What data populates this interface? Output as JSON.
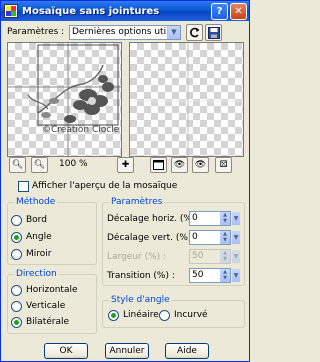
{
  "window": {
    "title": "Mosaïque sans jointures",
    "help": "?",
    "close": "✕"
  },
  "presets": {
    "label": "Paramètres :",
    "value": "Dernières options utilisées"
  },
  "preview": {
    "watermark": "©Creation Clocle",
    "zoom": "100 %"
  },
  "checkbox_preview": {
    "label": "Afficher l'aperçu de la mosaïque",
    "checked": false
  },
  "method": {
    "title": "Méthode",
    "options": [
      {
        "label": "Bord",
        "selected": false
      },
      {
        "label": "Angle",
        "selected": true
      },
      {
        "label": "Miroir",
        "selected": false
      }
    ]
  },
  "direction": {
    "title": "Direction",
    "options": [
      {
        "label": "Horizontale",
        "selected": false
      },
      {
        "label": "Verticale",
        "selected": false
      },
      {
        "label": "Bilatérale",
        "selected": true
      }
    ]
  },
  "params": {
    "title": "Paramètres",
    "fields": [
      {
        "label": "Décalage horiz. (%) :",
        "value": "0",
        "enabled": true
      },
      {
        "label": "Décalage vert. (%) :",
        "value": "0",
        "enabled": true
      },
      {
        "label": "Largeur (%) :",
        "value": "50",
        "enabled": false
      },
      {
        "label": "Transition (%) :",
        "value": "50",
        "enabled": true
      }
    ]
  },
  "corner_style": {
    "title": "Style d'angle",
    "options": [
      {
        "label": "Linéaire",
        "selected": true
      },
      {
        "label": "Incurvé",
        "selected": false
      }
    ]
  },
  "buttons": {
    "ok": "OK",
    "cancel": "Annuler",
    "help": "Aide"
  }
}
